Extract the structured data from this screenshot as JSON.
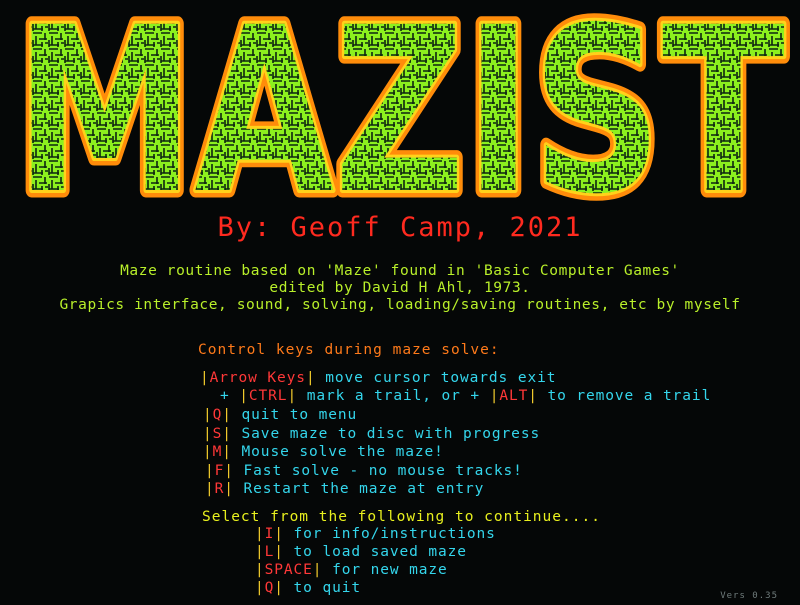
{
  "title": {
    "text": "MAZIST"
  },
  "author": {
    "text": "By: Geoff Camp, 2021"
  },
  "credits": [
    "Maze routine based on 'Maze' found in 'Basic Computer Games'",
    "edited by David H Ahl, 1973.",
    "Grapics interface, sound, solving, loading/saving routines, etc by myself"
  ],
  "controls": {
    "heading": "Control keys during maze solve:",
    "arrow": {
      "key": "Arrow Keys",
      "desc": " move cursor towards exit"
    },
    "ctrl": {
      "prefix": "+ ",
      "key": "CTRL",
      "mid": " mark a trail, or + ",
      "key2": "ALT",
      "desc": " to remove a trail"
    },
    "q": {
      "key": "Q",
      "desc": " quit to menu"
    },
    "s": {
      "key": "S",
      "desc": " Save maze to disc with progress"
    },
    "m": {
      "key": "M",
      "desc": " Mouse solve the maze!"
    },
    "f": {
      "key": "F",
      "desc": " Fast solve - no mouse tracks!"
    },
    "r": {
      "key": "R",
      "desc": " Restart the maze at entry"
    }
  },
  "menu": {
    "heading": "Select from the following to continue....",
    "items": [
      {
        "key": "I",
        "desc": " for info/instructions"
      },
      {
        "key": "L",
        "desc": " to load saved maze"
      },
      {
        "key": "SPACE",
        "desc": " for new maze"
      },
      {
        "key": "Q",
        "desc": " to quit"
      }
    ]
  },
  "version": "Vers 0.35",
  "colors": {
    "background": "#050707",
    "logo_fill": "#8cf01e",
    "logo_outline": "#ffa40a",
    "maze_walls": "#0c2410",
    "author": "#ff2a1f",
    "credits": "#b9f02a",
    "controls_heading": "#ff7a1a",
    "menu_heading": "#e8f01e",
    "key_text": "#ff3838",
    "description": "#34d6ec"
  }
}
